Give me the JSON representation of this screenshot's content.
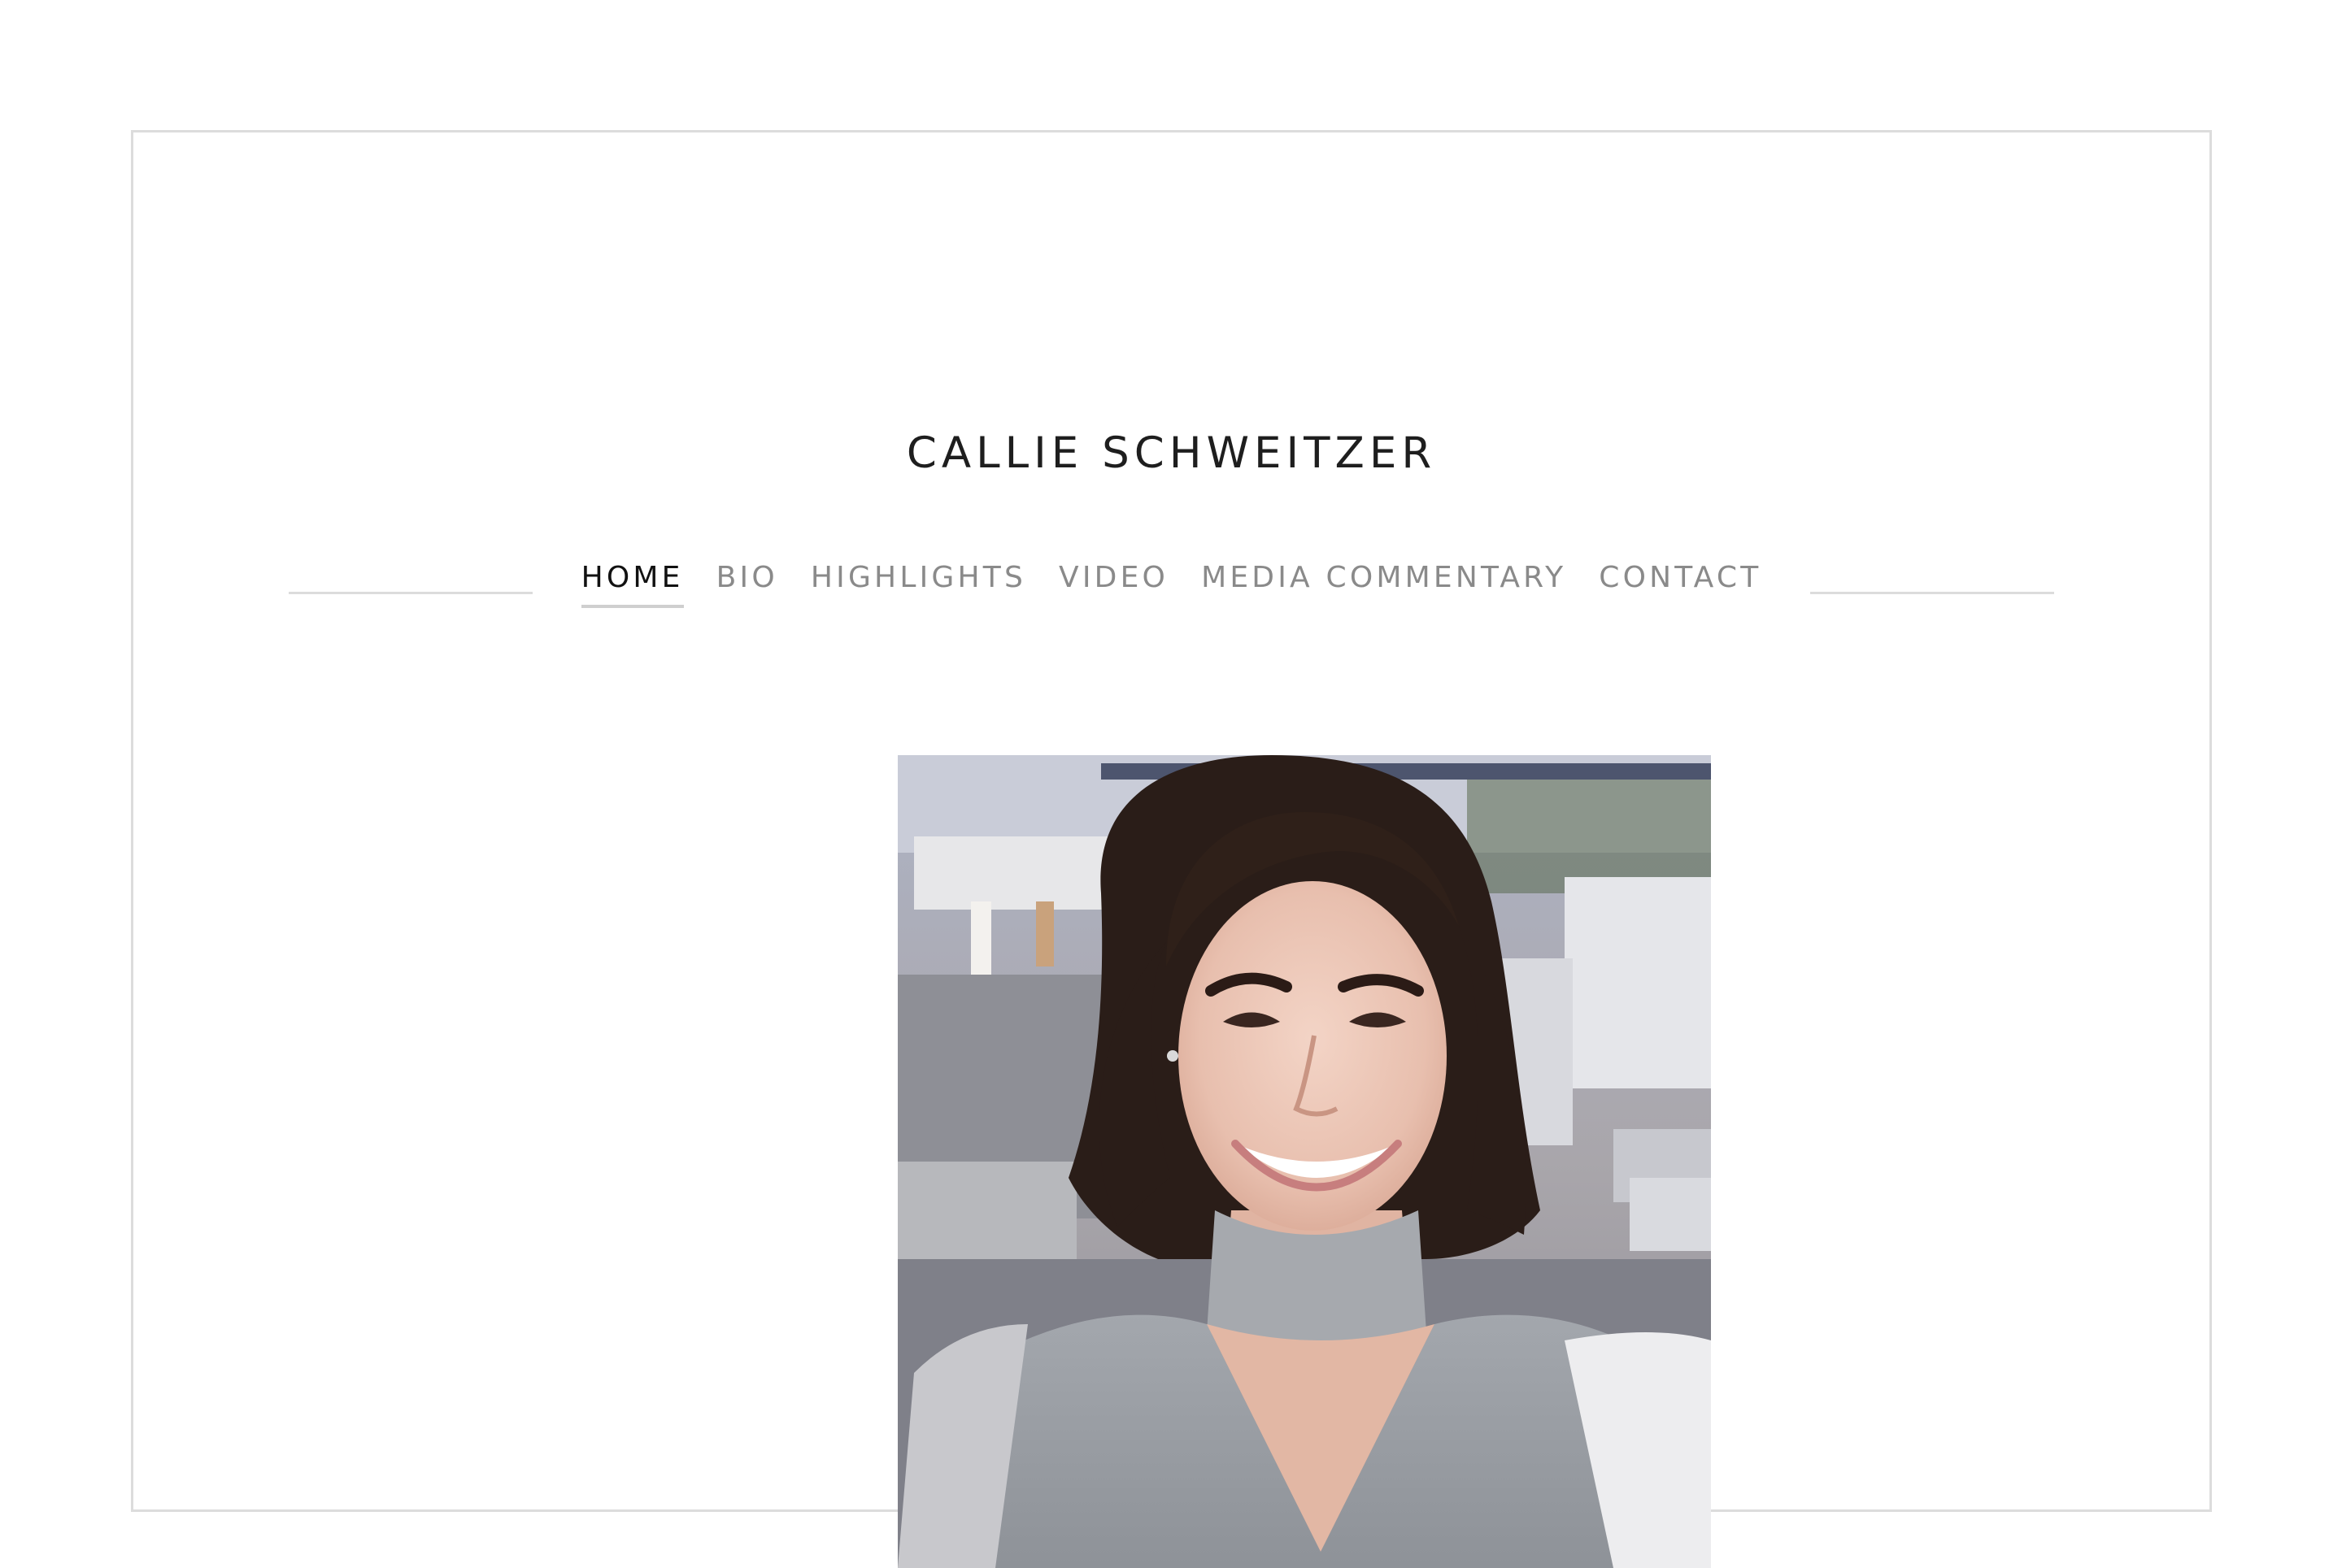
{
  "site": {
    "title": "CALLIE SCHWEITZER"
  },
  "nav": {
    "items": [
      {
        "label": "HOME",
        "active": true
      },
      {
        "label": "BIO",
        "active": false
      },
      {
        "label": "HIGHLIGHTS",
        "active": false
      },
      {
        "label": "VIDEO",
        "active": false
      },
      {
        "label": "MEDIA COMMENTARY",
        "active": false
      },
      {
        "label": "CONTACT",
        "active": false
      }
    ]
  },
  "colors": {
    "title": "#1e1e1e",
    "nav_active": "#111111",
    "nav_inactive": "#8a8a8a",
    "border": "#dcdcdc"
  },
  "hero": {
    "image": "portrait-photo"
  }
}
